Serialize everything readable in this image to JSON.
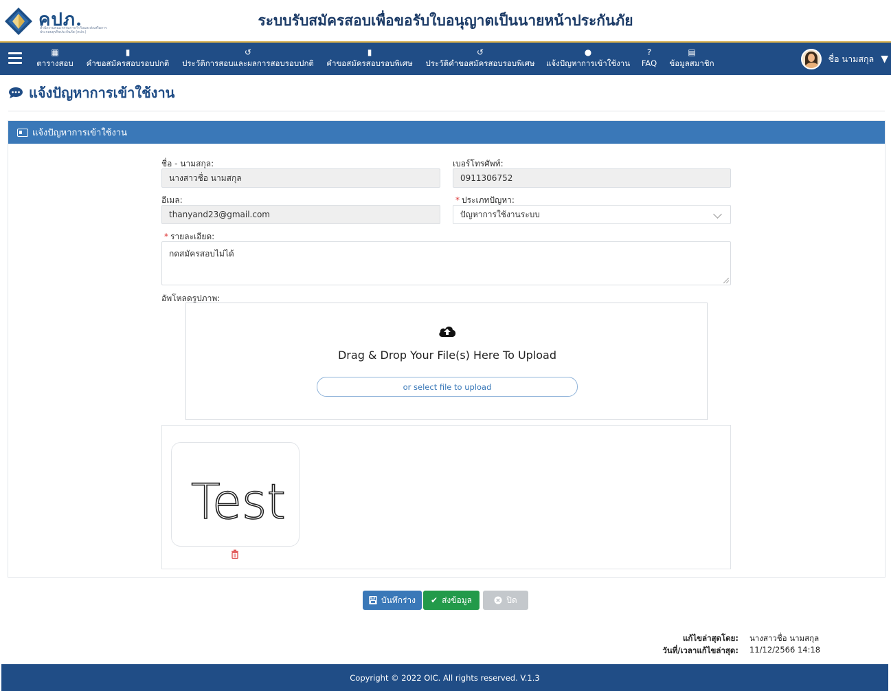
{
  "header": {
    "logo_text": "คปภ.",
    "logo_subtitle": "สำนักงานคณะกรรมการกำกับและส่งเสริมการประกอบธุรกิจประกันภัย (คปภ.)",
    "site_title": "ระบบรับสมัครสอบเพื่อขอรับใบอนุญาตเป็นนายหน้าประกันภัย"
  },
  "nav": {
    "items": [
      {
        "icon": "calendar-icon",
        "label": "ตารางสอบ"
      },
      {
        "icon": "document-icon",
        "label": "คำขอสมัครสอบรอบปกติ"
      },
      {
        "icon": "history-icon",
        "label": "ประวัติการสอบและผลการสอบรอบปกติ"
      },
      {
        "icon": "document-icon",
        "label": "คำขอสมัครสอบรอบพิเศษ"
      },
      {
        "icon": "history-icon",
        "label": "ประวัติคำขอสมัครสอบรอบพิเศษ"
      },
      {
        "icon": "comment-icon",
        "label": "แจ้งปัญหาการเข้าใช้งาน"
      },
      {
        "icon": "question-icon",
        "label": "FAQ"
      },
      {
        "icon": "id-card-icon",
        "label": "ข้อมูลสมาชิก"
      }
    ],
    "user_name": "ชื่อ นามสกุล"
  },
  "page": {
    "title": "แจ้งปัญหาการเข้าใช้งาน"
  },
  "panel": {
    "title": "แจ้งปัญหาการเข้าใช้งาน"
  },
  "form": {
    "name_label": "ชื่อ - นามสกุล:",
    "name_value": "นางสาวชื่อ นามสกุล",
    "phone_label": "เบอร์โทรศัพท์:",
    "phone_value": "0911306752",
    "email_label": "อีเมล:",
    "email_value": "thanyand23@gmail.com",
    "problem_type_label": "ประเภทปัญหา:",
    "problem_type_value": "ปัญหาการใช้งานระบบ",
    "detail_label": "รายละเอียด:",
    "detail_value": "กดสมัครสอบไม่ได้",
    "upload_label": "อัพโหลดรูปภาพ:",
    "required_mark": "*"
  },
  "upload": {
    "drop_text": "Drag & Drop Your File(s) Here To Upload",
    "select_button": "or select file to upload",
    "preview_text": "Test"
  },
  "buttons": {
    "save_draft": "บันทึกร่าง",
    "submit": "ส่งข้อมูล",
    "close": "ปิด"
  },
  "meta": {
    "edited_by_label": "แก้ไขล่าสุดโดย:",
    "edited_by_value": "นางสาวชื่อ นามสกุล",
    "edited_at_label": "วันที่/เวลาแก้ไขล่าสุด:",
    "edited_at_value": "11/12/2566 14:18"
  },
  "footer": {
    "copyright": "Copyright © 2022 OIC. All rights reserved. V.1.3"
  },
  "colors": {
    "nav_bg": "#204d86",
    "panel_head": "#3a78b8",
    "submit_green": "#229a4a",
    "accent_gold": "#d8b04c"
  }
}
